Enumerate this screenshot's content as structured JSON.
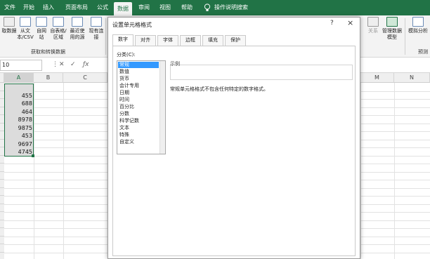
{
  "ribbon_tabs": [
    "文件",
    "开始",
    "插入",
    "页面布局",
    "公式",
    "数据",
    "审阅",
    "视图",
    "帮助",
    "操作说明搜索"
  ],
  "ribbon": {
    "get_data": "取数据",
    "from_text": "从文本/CSV",
    "from_web": "自网站",
    "from_table": "自表格/区域",
    "recent_sources": "最近使用的源",
    "existing_conn": "现有连接",
    "group_get": "获取和转换数据",
    "relations": "关系",
    "data_model": "管理数据模型",
    "what_if": "模拟分析",
    "forecast": "预测"
  },
  "namebox": "10",
  "columns": [
    "A",
    "B",
    "C",
    "M",
    "N"
  ],
  "cells": [
    "455",
    "688",
    "464",
    "8978",
    "9875",
    "453",
    "9697",
    "4745"
  ],
  "dialog": {
    "title": "设置单元格格式",
    "help": "?",
    "close": "×",
    "tabs": [
      "数字",
      "对齐",
      "字体",
      "边框",
      "填充",
      "保护"
    ],
    "category_label": "分类(C):",
    "categories": [
      "常规",
      "数值",
      "货币",
      "会计专用",
      "日期",
      "时间",
      "百分比",
      "分数",
      "科学记数",
      "文本",
      "特殊",
      "自定义"
    ],
    "sample_label": "示例",
    "description": "常规单元格格式不包含任何特定的数字格式。"
  },
  "colors": {
    "excel_green": "#217346",
    "selection": "#3399ff"
  }
}
